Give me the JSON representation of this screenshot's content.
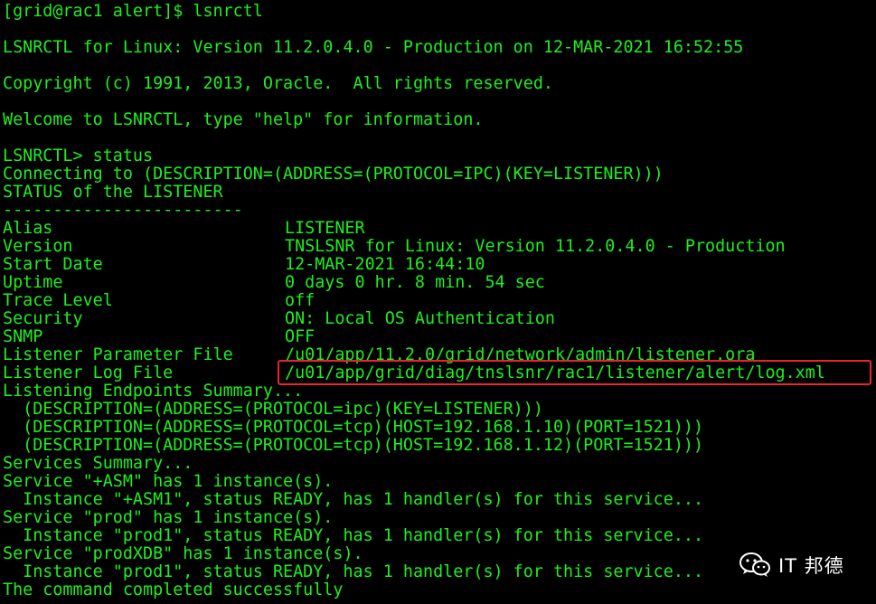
{
  "colors": {
    "background": "#000000",
    "text": "#1df01d",
    "highlight": "#e8262a",
    "watermark": "#ffffff"
  },
  "terminal": {
    "prompt_line": "[grid@rac1 alert]$ lsnrctl",
    "version_line": "LSNRCTL for Linux: Version 11.2.0.4.0 - Production on 12-MAR-2021 16:52:55",
    "copyright_line": "Copyright (c) 1991, 2013, Oracle.  All rights reserved.",
    "welcome_line": "Welcome to LSNRCTL, type \"help\" for information.",
    "command_line": "LSNRCTL> status",
    "connecting_line": "Connecting to (DESCRIPTION=(ADDRESS=(PROTOCOL=IPC)(KEY=LISTENER)))",
    "status_header": "STATUS of the LISTENER",
    "separator": "------------------------",
    "status_rows": [
      {
        "key": "Alias",
        "value": "LISTENER"
      },
      {
        "key": "Version",
        "value": "TNSLSNR for Linux: Version 11.2.0.4.0 - Production"
      },
      {
        "key": "Start Date",
        "value": "12-MAR-2021 16:44:10"
      },
      {
        "key": "Uptime",
        "value": "0 days 0 hr. 8 min. 54 sec"
      },
      {
        "key": "Trace Level",
        "value": "off"
      },
      {
        "key": "Security",
        "value": "ON: Local OS Authentication"
      },
      {
        "key": "SNMP",
        "value": "OFF"
      },
      {
        "key": "Listener Parameter File",
        "value": "/u01/app/11.2.0/grid/network/admin/listener.ora"
      },
      {
        "key": "Listener Log File",
        "value": "/u01/app/grid/diag/tnslsnr/rac1/listener/alert/log.xml"
      }
    ],
    "endpoints_header": "Listening Endpoints Summary...",
    "endpoints": [
      "  (DESCRIPTION=(ADDRESS=(PROTOCOL=ipc)(KEY=LISTENER)))",
      "  (DESCRIPTION=(ADDRESS=(PROTOCOL=tcp)(HOST=192.168.1.10)(PORT=1521)))",
      "  (DESCRIPTION=(ADDRESS=(PROTOCOL=tcp)(HOST=192.168.1.12)(PORT=1521)))"
    ],
    "services_header": "Services Summary...",
    "services": [
      "Service \"+ASM\" has 1 instance(s).",
      "  Instance \"+ASM1\", status READY, has 1 handler(s) for this service...",
      "Service \"prod\" has 1 instance(s).",
      "  Instance \"prod1\", status READY, has 1 handler(s) for this service...",
      "Service \"prodXDB\" has 1 instance(s).",
      "  Instance \"prod1\", status READY, has 1 handler(s) for this service..."
    ],
    "completed_line": "The command completed successfully"
  },
  "watermark": {
    "icon": "wechat-icon",
    "text": "IT 邦德"
  }
}
